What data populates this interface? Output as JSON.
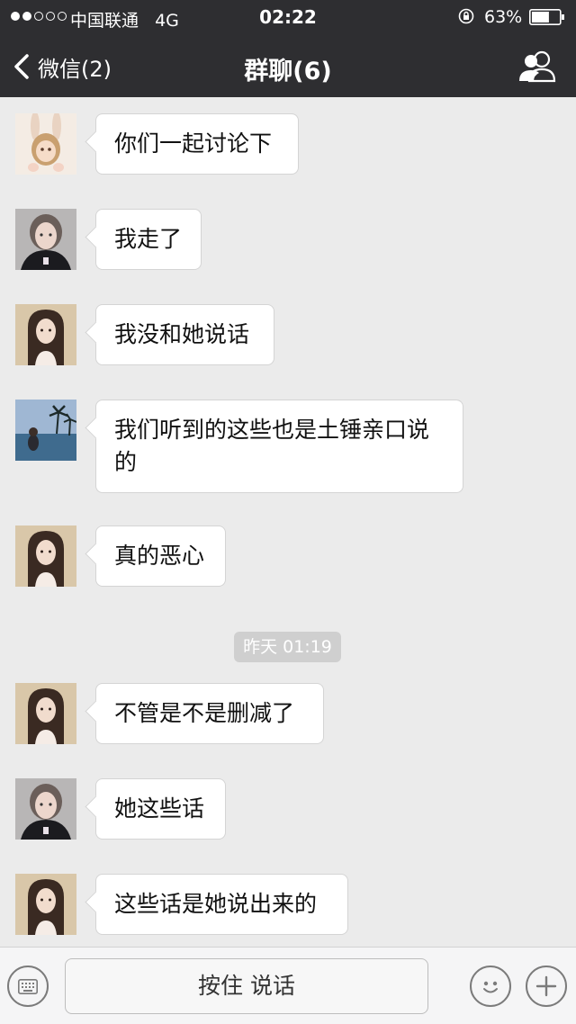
{
  "status_bar": {
    "carrier": "中国联通",
    "network": "4G",
    "time": "02:22",
    "battery_percent": "63%",
    "battery_level": 0.63
  },
  "nav": {
    "back_label": "微信(2)",
    "title": "群聊(6)"
  },
  "messages": [
    {
      "text": "你们一起讨论下",
      "avatar": "bunny-girl-avatar"
    },
    {
      "text": "我走了",
      "avatar": "dark-top-girl-avatar"
    },
    {
      "text": "我没和她说话",
      "avatar": "long-hair-girl-avatar"
    },
    {
      "text": "我们听到的这些也是土锤亲口说的",
      "avatar": "beach-palm-avatar"
    },
    {
      "text": "真的恶心",
      "avatar": "long-hair-girl-avatar"
    },
    {
      "text": "不管是不是删减了",
      "avatar": "long-hair-girl-avatar"
    },
    {
      "text": "她这些话",
      "avatar": "dark-top-girl-avatar"
    },
    {
      "text": "这些话是她说出来的",
      "avatar": "long-hair-girl-avatar"
    }
  ],
  "timestamp": "昨天 01:19",
  "input_bar": {
    "hold_to_talk_label": "按住 说话"
  },
  "colors": {
    "header_bg": "#2e2e31",
    "chat_bg": "#ebebeb",
    "bubble_bg": "#ffffff",
    "timestamp_bg": "#cfcfcf"
  }
}
